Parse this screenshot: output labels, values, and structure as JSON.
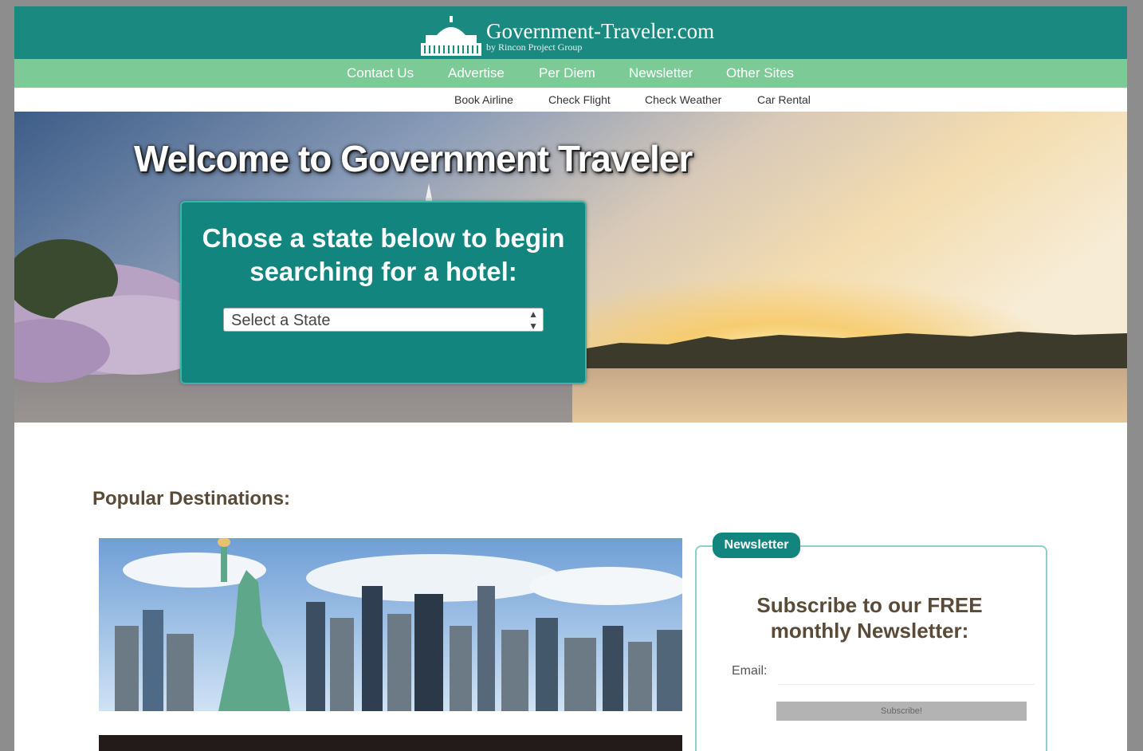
{
  "header": {
    "site_name": "Government-Traveler.com",
    "tagline": "by Rincon Project Group"
  },
  "nav": {
    "items": [
      {
        "label": "Contact Us"
      },
      {
        "label": "Advertise"
      },
      {
        "label": "Per Diem"
      },
      {
        "label": "Newsletter"
      },
      {
        "label": "Other Sites"
      }
    ]
  },
  "subnav": {
    "items": [
      {
        "label": "Book Airline"
      },
      {
        "label": "Check Flight"
      },
      {
        "label": "Check Weather"
      },
      {
        "label": "Car Rental"
      }
    ]
  },
  "hero": {
    "title": "Welcome to Government Traveler",
    "search_heading_line1": "Chose a state below to begin",
    "search_heading_line2": "searching for a hotel:",
    "state_select_value": "Select a State"
  },
  "main": {
    "section_title": "Popular Destinations:"
  },
  "newsletter": {
    "tab_label": "Newsletter",
    "heading_line1": "Subscribe to our FREE",
    "heading_line2": "monthly Newsletter:",
    "email_label": "Email:",
    "email_value": "",
    "subscribe_label": "Subscribe!"
  },
  "colors": {
    "header_teal": "#1a8a80",
    "nav_green": "#7ccb96",
    "heading_brown": "#5a4a38"
  }
}
